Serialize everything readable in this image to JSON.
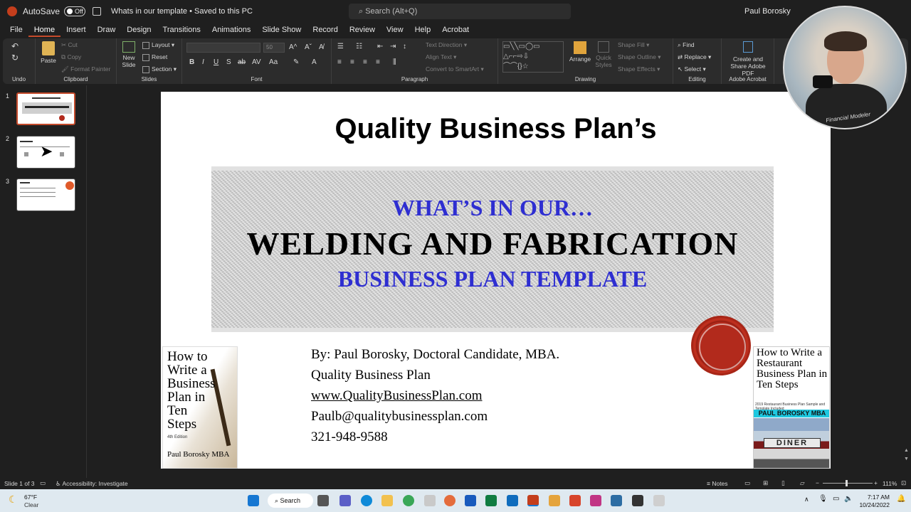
{
  "titlebar": {
    "autosave_label": "AutoSave",
    "autosave_state": "Off",
    "document": "Whats in our template • Saved to this PC",
    "search_placeholder": "Search (Alt+Q)",
    "user": "Paul Borosky"
  },
  "menu": [
    "File",
    "Home",
    "Insert",
    "Draw",
    "Design",
    "Transitions",
    "Animations",
    "Slide Show",
    "Record",
    "Review",
    "View",
    "Help",
    "Acrobat"
  ],
  "menu_active": "Home",
  "ribbon": {
    "undo_label": "Undo",
    "clipboard": {
      "paste": "Paste",
      "cut": "Cut",
      "copy": "Copy",
      "format_painter": "Format Painter",
      "label": "Clipboard"
    },
    "slides": {
      "new_slide": "New Slide",
      "layout": "Layout",
      "reset": "Reset",
      "section": "Section",
      "label": "Slides"
    },
    "font": {
      "size": "50",
      "label": "Font"
    },
    "paragraph": {
      "text_direction": "Text Direction",
      "align_text": "Align Text",
      "convert_smartart": "Convert to SmartArt",
      "label": "Paragraph"
    },
    "drawing": {
      "arrange": "Arrange",
      "quick_styles": "Quick Styles",
      "shape_fill": "Shape Fill",
      "shape_outline": "Shape Outline",
      "shape_effects": "Shape Effects",
      "label": "Drawing"
    },
    "editing": {
      "find": "Find",
      "replace": "Replace",
      "select": "Select",
      "label": "Editing"
    },
    "acrobat": {
      "create_share": "Create and Share Adobe PDF",
      "label": "Adobe Acrobat"
    }
  },
  "thumbnails": [
    {
      "num": "1",
      "selected": true
    },
    {
      "num": "2",
      "selected": false
    },
    {
      "num": "3",
      "selected": false
    }
  ],
  "slide": {
    "title": "Quality Business Plan’s",
    "banner_line1": "WHAT’S IN OUR…",
    "banner_line2": "WELDING AND FABRICATION",
    "banner_line3": "BUSINESS PLAN TEMPLATE",
    "byline": "By: Paul Borosky, Doctoral Candidate, MBA.",
    "company": "Quality Business Plan",
    "website": "www.QualityBusinessPlan.com",
    "email": "Paulb@qualitybusinessplan.com",
    "phone": "321-948-9588",
    "book_left": {
      "title": "How to Write a Business Plan in Ten Steps",
      "edition": "4th Edition",
      "author": "Paul Borosky MBA"
    },
    "book_right": {
      "title": "How to Write a Restaurant Business Plan in Ten Steps",
      "subtitle": "2019 Restaurant Business Plan Sample and Template Included",
      "author": "PAUL BOROSKY MBA",
      "sign": "DINER"
    }
  },
  "webcam": {
    "shirt_text": "Financial Modeler"
  },
  "statusbar": {
    "slide_info": "Slide 1 of 3",
    "accessibility": "Accessibility: Investigate",
    "notes": "Notes",
    "zoom": "111%"
  },
  "taskbar": {
    "weather_temp": "67°F",
    "weather_desc": "Clear",
    "search": "Search",
    "time": "7:17 AM",
    "date": "10/24/2022"
  },
  "colors": {
    "accent": "#c44a2b",
    "banner_blue": "#2e2ed1"
  }
}
